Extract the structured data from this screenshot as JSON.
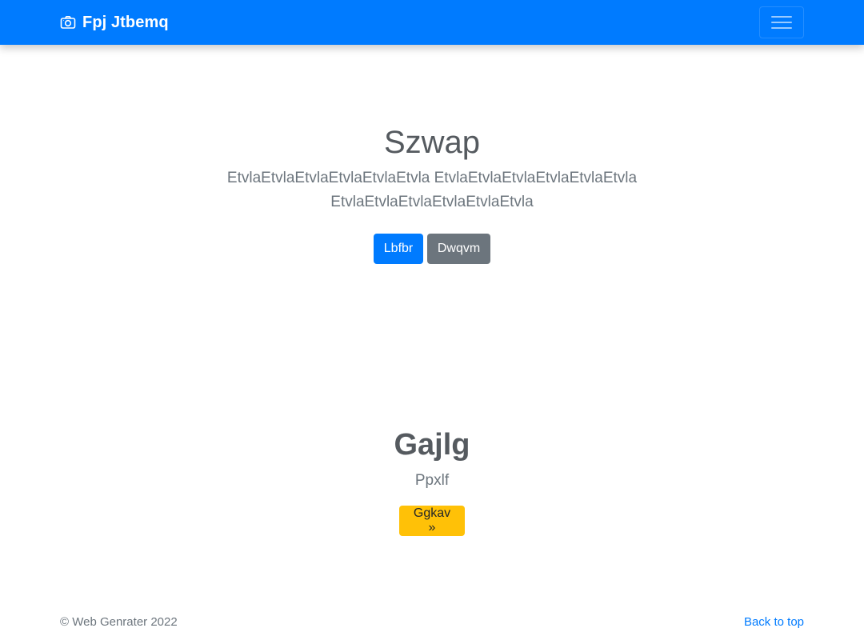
{
  "navbar": {
    "brand_icon": "camera-icon",
    "brand": "Fpj Jtbemq",
    "toggler_icon": "hamburger-menu-icon",
    "color": "#007bff"
  },
  "hero": {
    "title": "Szwap",
    "lead": "EtvlaEtvlaEtvlaEtvlaEtvlaEtvla EtvlaEtvlaEtvlaEtvlaEtvlaEtvla EtvlaEtvlaEtvlaEtvlaEtvlaEtvla",
    "primary_button": "Lbfbr",
    "secondary_button": "Dwqvm"
  },
  "feature": {
    "title": "Gajlg",
    "subtitle": "Ppxlf",
    "button": "Ggkav »"
  },
  "footer": {
    "copyright": "© Web Genrater 2022",
    "back_to_top": "Back to top"
  },
  "colors": {
    "primary": "#007bff",
    "secondary": "#6c757d",
    "warning": "#ffc107"
  }
}
